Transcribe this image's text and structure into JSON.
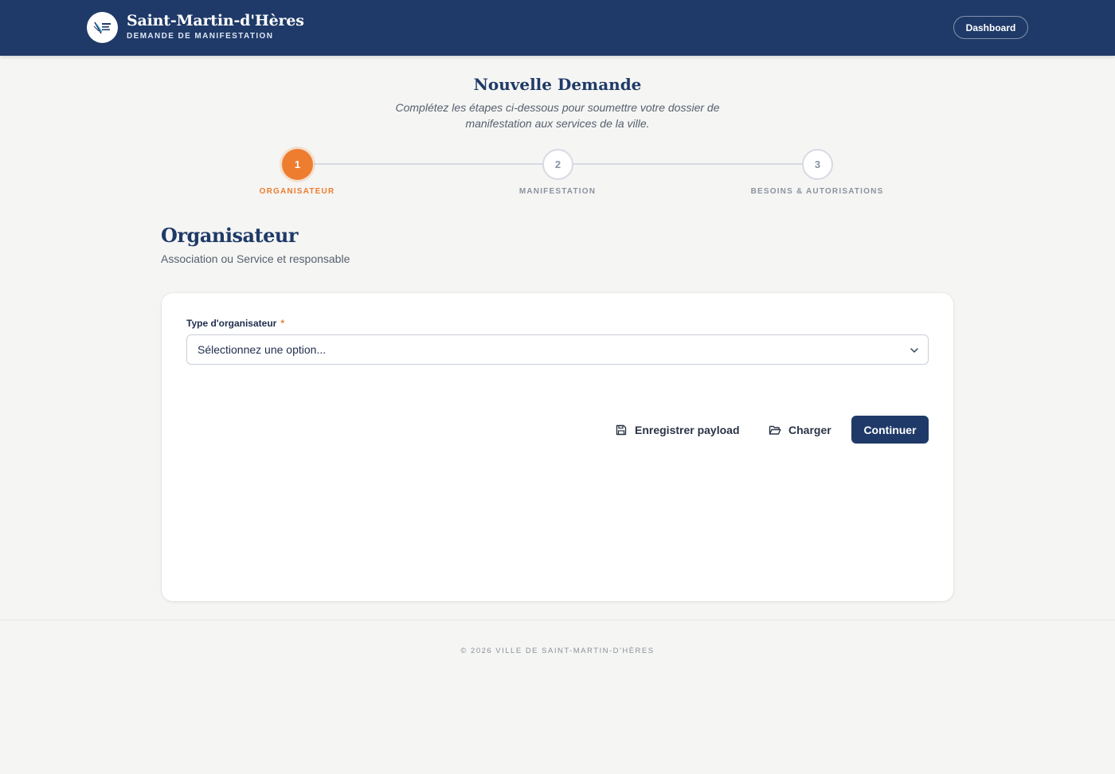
{
  "header": {
    "title": "Saint-Martin-d'Hères",
    "subtitle": "DEMANDE DE MANIFESTATION",
    "dashboard_label": "Dashboard"
  },
  "page": {
    "title": "Nouvelle Demande",
    "subtitle": "Complétez les étapes ci-dessous pour soumettre votre dossier de manifestation aux services de la ville."
  },
  "stepper": {
    "steps": [
      {
        "number": "1",
        "label": "ORGANISATEUR",
        "active": true
      },
      {
        "number": "2",
        "label": "MANIFESTATION",
        "active": false
      },
      {
        "number": "3",
        "label": "BESOINS & AUTORISATIONS",
        "active": false
      }
    ]
  },
  "section": {
    "title": "Organisateur",
    "subtitle": "Association ou Service et responsable"
  },
  "form": {
    "organizer_type_label": "Type d'organisateur",
    "required_marker": "*",
    "organizer_type_value": "Sélectionnez une option..."
  },
  "actions": {
    "save_label": "Enregistrer payload",
    "load_label": "Charger",
    "continue_label": "Continuer"
  },
  "footer": {
    "copyright": "© 2026 VILLE DE SAINT-MARTIN-D'HÈRES"
  },
  "colors": {
    "primary": "#1f3a68",
    "accent": "#ee7d2f",
    "background": "#f5f5f3"
  },
  "icons": {
    "logo": "city-logo-icon",
    "save": "floppy-disk-icon",
    "load": "folder-open-icon",
    "select": "chevron-down-icon"
  }
}
